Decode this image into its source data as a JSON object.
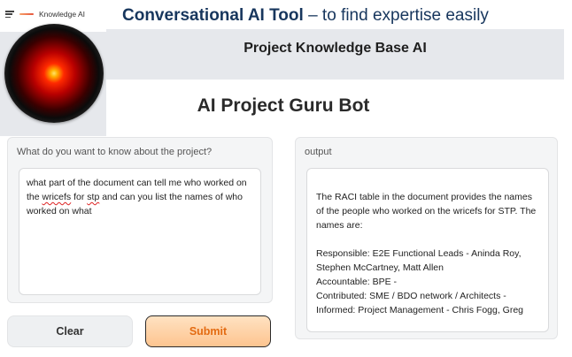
{
  "nav": {
    "brand": "Knowledge AI"
  },
  "slide": {
    "title_bold": "Conversational AI Tool",
    "title_rest": " – to find expertise easily"
  },
  "header": {
    "title": "Project Knowledge Base AI"
  },
  "bot": {
    "title": "AI Project Guru Bot"
  },
  "input": {
    "label": "What do you want to know about the project?",
    "value_1": "what part of the document can tell me who worked on the ",
    "value_2": "wricefs",
    "value_3": " for ",
    "value_4": "stp",
    "value_5": " and can you list the names of who worked on what"
  },
  "output": {
    "label": "output",
    "value": "The RACI table in the document provides the names of the people who worked on the wricefs for STP. The names are:\n\nResponsible: E2E Functional Leads - Aninda Roy, Stephen McCartney, Matt Allen\nAccountable: BPE -\nContributed: SME / BDO network / Architects -\nInformed: Project Management - Chris Fogg, Greg"
  },
  "buttons": {
    "clear": "Clear",
    "submit": "Submit"
  },
  "colors": {
    "accent_orange": "#e36b12",
    "submit_bg": "#fdc48f",
    "title_navy": "#17365d"
  }
}
